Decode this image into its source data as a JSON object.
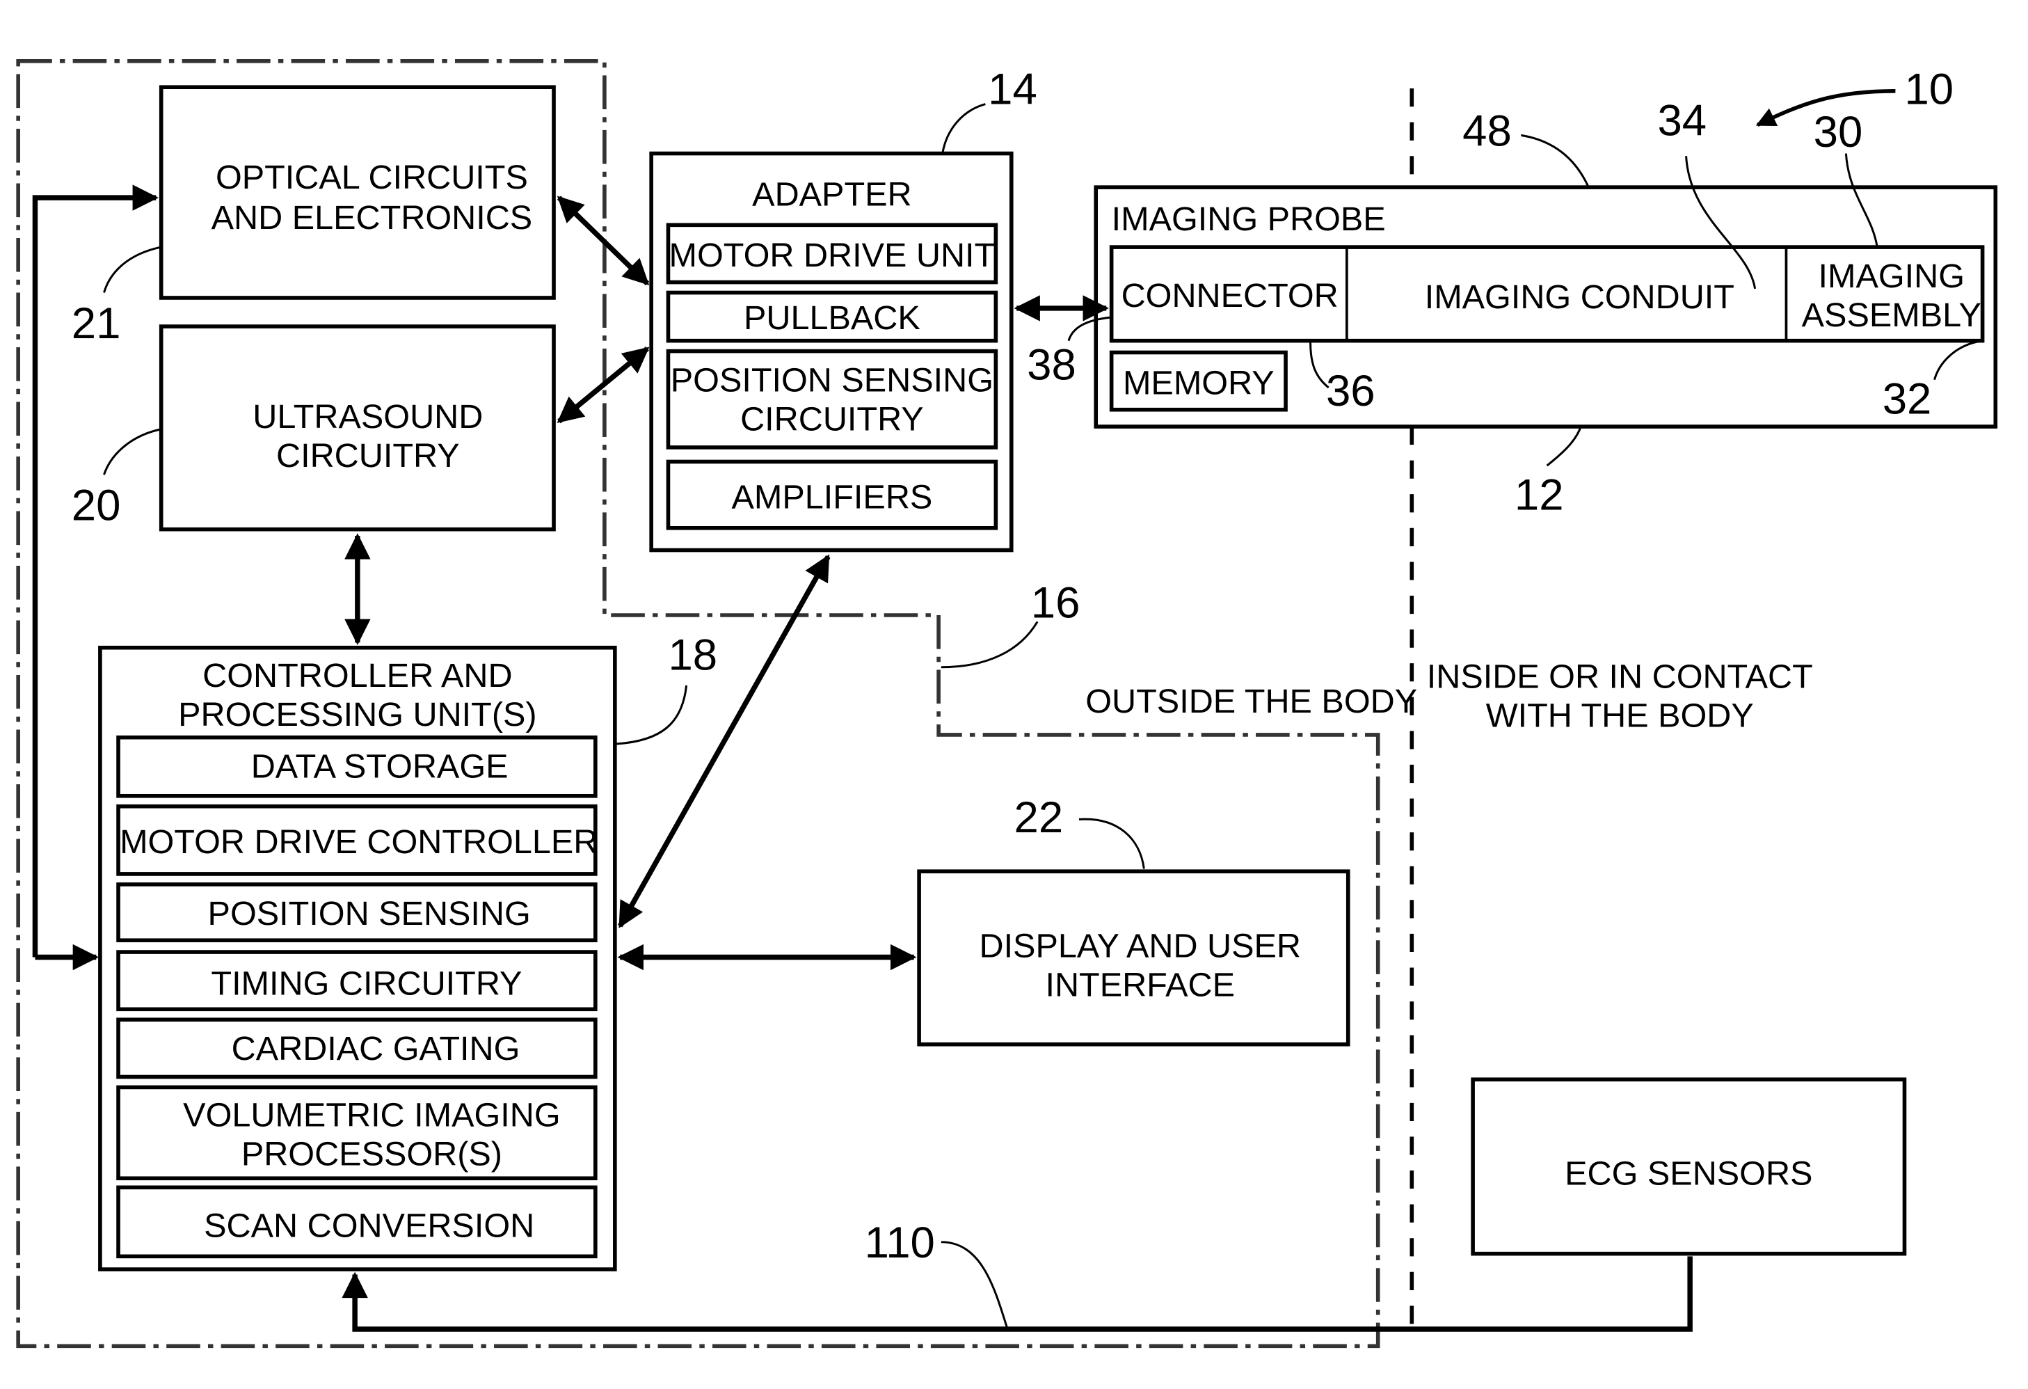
{
  "figure": {
    "system_ref": "10",
    "optical": {
      "ref": "21",
      "lines": [
        "OPTICAL CIRCUITS",
        "AND ELECTRONICS"
      ]
    },
    "ultrasound": {
      "ref": "20",
      "lines": [
        "ULTRASOUND",
        "CIRCUITRY"
      ]
    },
    "adapter": {
      "ref": "14",
      "title": "ADAPTER",
      "items": [
        {
          "lines": [
            "MOTOR DRIVE UNIT"
          ]
        },
        {
          "lines": [
            "PULLBACK"
          ]
        },
        {
          "lines": [
            "POSITION SENSING",
            "CIRCUITRY"
          ]
        },
        {
          "lines": [
            "AMPLIFIERS"
          ]
        }
      ]
    },
    "probe": {
      "ref": "12",
      "title": "IMAGING PROBE",
      "housing_ref": "48",
      "connector": {
        "label": "CONNECTOR",
        "ref": "36"
      },
      "conduit": {
        "label": "IMAGING CONDUIT",
        "ref": "34"
      },
      "assembly": {
        "lines": [
          "IMAGING",
          "ASSEMBLY"
        ],
        "ref": "30",
        "tip_ref": "32"
      },
      "memory": "MEMORY",
      "link_ref": "38"
    },
    "controller": {
      "ref": "18",
      "title_lines": [
        "CONTROLLER AND",
        "PROCESSING UNIT(S)"
      ],
      "items": [
        {
          "lines": [
            "DATA STORAGE"
          ]
        },
        {
          "lines": [
            "MOTOR DRIVE CONTROLLER"
          ]
        },
        {
          "lines": [
            "POSITION SENSING"
          ]
        },
        {
          "lines": [
            "TIMING CIRCUITRY"
          ]
        },
        {
          "lines": [
            "CARDIAC GATING"
          ]
        },
        {
          "lines": [
            "VOLUMETRIC IMAGING",
            "PROCESSOR(S)"
          ]
        },
        {
          "lines": [
            "SCAN CONVERSION"
          ]
        }
      ]
    },
    "display": {
      "ref": "22",
      "lines": [
        "DISPLAY AND USER",
        "INTERFACE"
      ]
    },
    "ecg": {
      "label": "ECG SENSORS",
      "line_ref": "110"
    },
    "boundary_ref": "16",
    "regions": {
      "outside": "OUTSIDE THE BODY",
      "inside_lines": [
        "INSIDE OR IN CONTACT",
        "WITH THE BODY"
      ]
    }
  }
}
